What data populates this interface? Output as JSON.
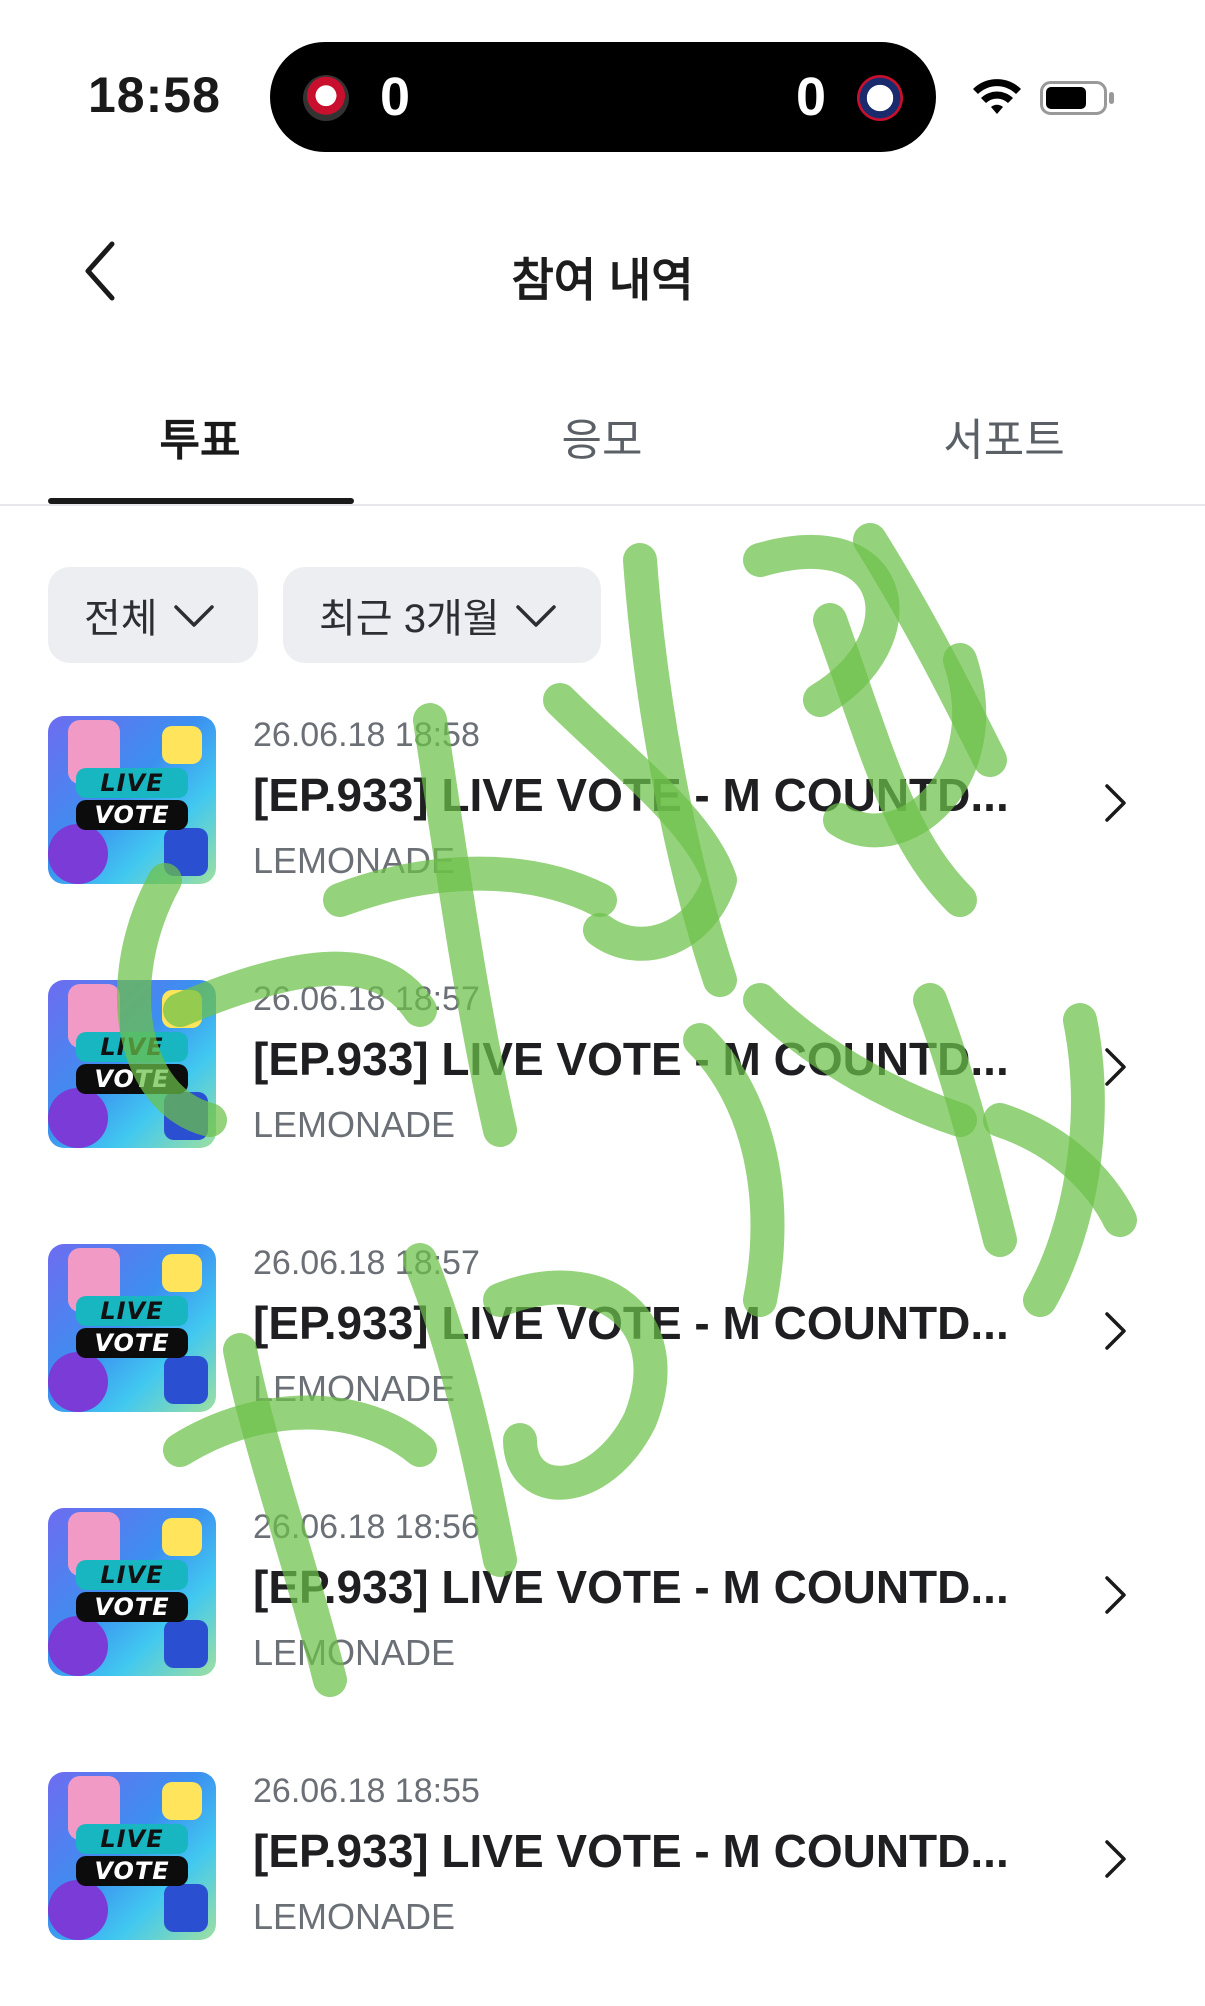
{
  "status_bar": {
    "time": "18:58",
    "live_activity": {
      "left_score": "0",
      "right_score": "0",
      "left_logo": "kt-wiz-logo",
      "right_logo": "bears-logo"
    },
    "icons": [
      "wifi-icon",
      "battery-icon"
    ]
  },
  "header": {
    "title": "참여 내역",
    "back_icon": "chevron-left-icon"
  },
  "tabs": [
    {
      "label": "투표",
      "active": true
    },
    {
      "label": "응모",
      "active": false
    },
    {
      "label": "서포트",
      "active": false
    }
  ],
  "filters": [
    {
      "label": "전체"
    },
    {
      "label": "최근 3개월"
    }
  ],
  "thumbnail": {
    "line1": "LIVE",
    "line2": "VOTE"
  },
  "items": [
    {
      "date": "26.06.18 18:58",
      "title": "[EP.933] LIVE VOTE - M COUNTD...",
      "artist": "LEMONADE"
    },
    {
      "date": "26.06.18 18:57",
      "title": "[EP.933] LIVE VOTE - M COUNTD...",
      "artist": "LEMONADE"
    },
    {
      "date": "26.06.18 18:57",
      "title": "[EP.933] LIVE VOTE - M COUNTD...",
      "artist": "LEMONADE"
    },
    {
      "date": "26.06.18 18:56",
      "title": "[EP.933] LIVE VOTE - M COUNTD...",
      "artist": "LEMONADE"
    },
    {
      "date": "26.06.18 18:55",
      "title": "[EP.933] LIVE VOTE - M COUNTD...",
      "artist": "LEMONADE"
    }
  ],
  "colors": {
    "accent": "#1a1a1a",
    "chip_background": "#eceef1",
    "scribble": "#6cc04a"
  }
}
